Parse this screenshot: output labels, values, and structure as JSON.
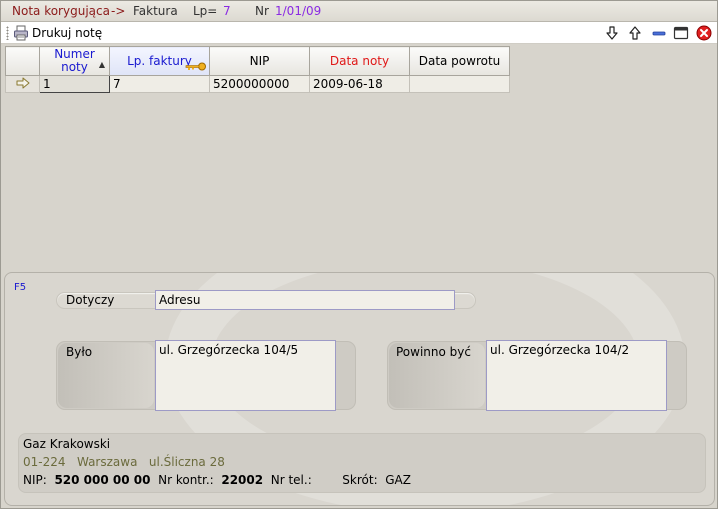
{
  "titlebar": {
    "doc_type": "Nota korygująca",
    "arrow": "->",
    "target": "Faktura",
    "lp_label": "Lp=",
    "lp_value": "7",
    "nr_label": "Nr",
    "nr_value": "1/01/09"
  },
  "toolbar": {
    "print_label": "Drukuj notę"
  },
  "grid": {
    "columns": [
      {
        "label_line1": "Numer",
        "label_line2": "noty"
      },
      {
        "label": "Lp. faktury"
      },
      {
        "label": "NIP"
      },
      {
        "label": "Data noty"
      },
      {
        "label": "Data powrotu"
      }
    ],
    "rows": [
      {
        "numer_noty": "1",
        "lp_faktury": "7",
        "nip": "5200000000",
        "data_noty": "2009-06-18",
        "data_powrotu": ""
      }
    ]
  },
  "form": {
    "shortcut": "F5",
    "dotyczy_label": "Dotyczy",
    "dotyczy_value": "Adresu",
    "bylo_label": "Było",
    "bylo_value": "ul. Grzegórzecka 104/5",
    "powinno_label": "Powinno być",
    "powinno_value": "ul. Grzegórzecka 104/2"
  },
  "client": {
    "name": "Gaz Krakowski",
    "postal_code": "01-224",
    "city": "Warszawa",
    "street": "ul.Śliczna 28",
    "nip_label": "NIP:",
    "nip_value": "520 000 00 00",
    "contract_label": "Nr kontr.:",
    "contract_value": "22002",
    "phone_label": "Nr tel.:",
    "phone_value": "",
    "short_label": "Skrót:",
    "short_value": "GAZ"
  },
  "colors": {
    "background": "#d7d4cc",
    "accent_blue": "#1a1ad0",
    "accent_red": "#e01818",
    "title_maroon": "#8b1a1a",
    "title_purple": "#8a2be2"
  }
}
